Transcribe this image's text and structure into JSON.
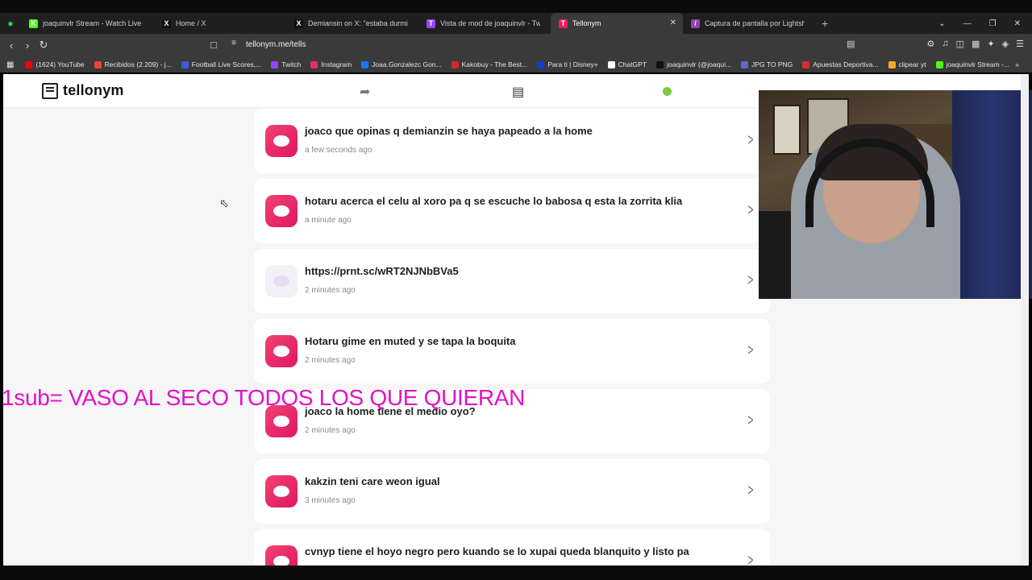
{
  "tabs": [
    {
      "label": "joaquinvlr Stream - Watch Live on",
      "color": "#53fc18",
      "glyph": "K"
    },
    {
      "label": "Home / X",
      "color": "#111111",
      "glyph": "X"
    },
    {
      "label": "Demiansin on X: \"estaba durmiendo",
      "color": "#111111",
      "glyph": "X"
    },
    {
      "label": "Vista de mod de joaquinvlr - Twit",
      "color": "#9146ff",
      "glyph": "T"
    },
    {
      "label": "Tellonym",
      "color": "#e81b66",
      "glyph": "T",
      "active": true
    },
    {
      "label": "Captura de pantalla por Lightshot",
      "color": "#8e44ad",
      "glyph": "/"
    }
  ],
  "address": {
    "url": "tellonym.me/tells"
  },
  "bookmarks": [
    {
      "label": "(1624) YouTube",
      "color": "#ff0000"
    },
    {
      "label": "Recibidos (2.209) - j...",
      "color": "#ea4335"
    },
    {
      "label": "Football Live Scores,...",
      "color": "#3b5bdb"
    },
    {
      "label": "Twitch",
      "color": "#9146ff"
    },
    {
      "label": "Instagram",
      "color": "#e1306c"
    },
    {
      "label": "Joaa.Gonzalezc Gon...",
      "color": "#1877f2"
    },
    {
      "label": "Kakobuy - The Best...",
      "color": "#d62828"
    },
    {
      "label": "Para ti | Disney+",
      "color": "#113ccf"
    },
    {
      "label": "ChatGPT",
      "color": "#ffffff"
    },
    {
      "label": "joaquinvlr (@joaqui...",
      "color": "#111111"
    },
    {
      "label": "JPG TO PNG",
      "color": "#5c6bc0"
    },
    {
      "label": "Apuestas Deportiva...",
      "color": "#d32f2f"
    },
    {
      "label": "clipear yt",
      "color": "#f9a825"
    },
    {
      "label": "joaquinvlr Stream -...",
      "color": "#53fc18"
    }
  ],
  "header": {
    "logo": "tellonym",
    "dot_color": "#7bc843"
  },
  "tells": [
    {
      "text": "joaco que opinas q demianzin se haya papeado a la home",
      "time": "a few seconds ago",
      "muted": false
    },
    {
      "text": "hotaru acerca el celu al xoro pa q se escuche lo babosa q esta la zorrita klia",
      "time": "a minute ago",
      "muted": false
    },
    {
      "text": "https://prnt.sc/wRT2NJNbBVa5",
      "time": "2 minutes ago",
      "muted": true
    },
    {
      "text": "Hotaru gime en muted y se tapa la boquita",
      "time": "2 minutes ago",
      "muted": false
    },
    {
      "text": "joaco la home tiene el medio oyo?",
      "time": "2 minutes ago",
      "muted": false
    },
    {
      "text": "kakzin teni care weon igual",
      "time": "3 minutes ago",
      "muted": false
    },
    {
      "text": "cvnyp tiene el hoyo negro pero kuando se lo xupai queda blanquito y listo pa",
      "time": "",
      "muted": false
    }
  ],
  "overlay": {
    "text": "1sub= VASO AL SECO TODOS LOS QUE QUIERAN",
    "color": "#e012c8"
  }
}
